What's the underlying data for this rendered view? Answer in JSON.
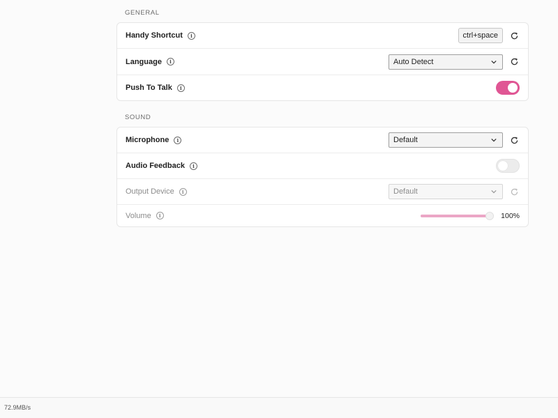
{
  "general": {
    "title": "GENERAL",
    "handy_shortcut": {
      "label": "Handy Shortcut",
      "key": "ctrl+space"
    },
    "language": {
      "label": "Language",
      "selected": "Auto Detect"
    },
    "push_to_talk": {
      "label": "Push To Talk",
      "enabled": true
    }
  },
  "sound": {
    "title": "SOUND",
    "microphone": {
      "label": "Microphone",
      "selected": "Default"
    },
    "audio_feedback": {
      "label": "Audio Feedback",
      "enabled": false
    },
    "output_device": {
      "label": "Output Device",
      "selected": "Default",
      "disabled": true
    },
    "volume": {
      "label": "Volume",
      "value_text": "100%",
      "level": 1.0
    }
  },
  "status_bar": {
    "text": "72.9MB/s"
  },
  "colors": {
    "accent": "#e05694",
    "accent_light": "#eba6c6"
  },
  "icons": {
    "info": "info-icon",
    "reset": "reset-icon",
    "dropdown": "chevron-down-icon"
  }
}
